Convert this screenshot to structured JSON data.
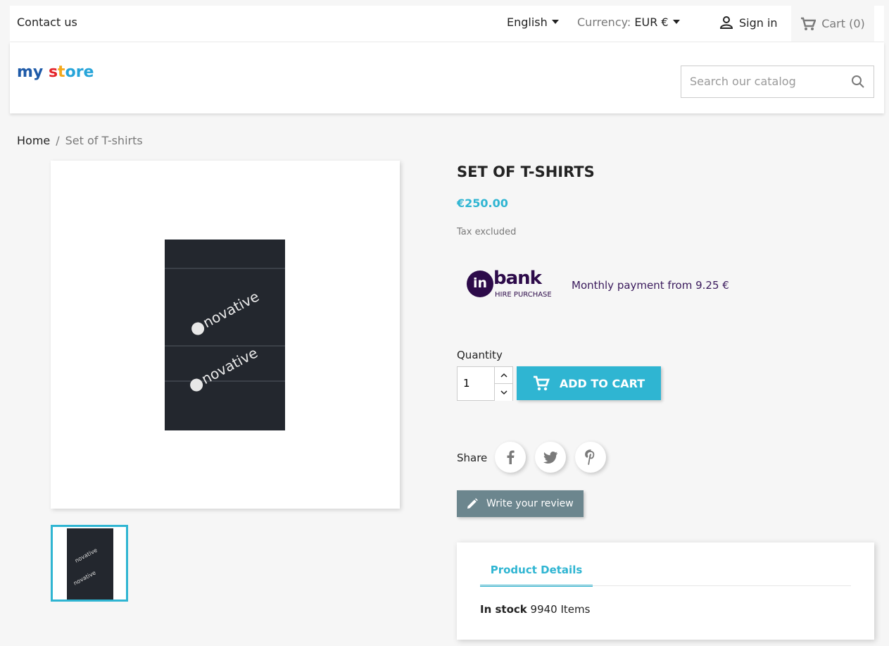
{
  "topbar": {
    "contact": "Contact us",
    "language": "English",
    "currency_label": "Currency:",
    "currency_value": "EUR €",
    "signin": "Sign in",
    "cart": "Cart (0)"
  },
  "header": {
    "logo_part1": "my",
    "logo_part2": "s",
    "logo_part3": "t",
    "logo_part4": "ore",
    "search_placeholder": "Search our catalog"
  },
  "breadcrumb": {
    "home": "Home",
    "separator": "/",
    "current": "Set of T-shirts"
  },
  "product": {
    "title": "SET OF T-SHIRTS",
    "price": "€250.00",
    "tax": "Tax excluded",
    "image_brand": "novative",
    "image_brand_prefix": "in"
  },
  "inbank": {
    "logo_prefix": "in",
    "logo_word": "bank",
    "logo_sub": "HIRE PURCHASE",
    "monthly": "Monthly payment from 9.25 €"
  },
  "purchase": {
    "quantity_label": "Quantity",
    "quantity_value": "1",
    "add_to_cart": "ADD TO CART"
  },
  "share": {
    "label": "Share"
  },
  "review": {
    "label": "Write your review"
  },
  "details": {
    "tab": "Product Details",
    "stock_label": "In stock",
    "stock_value": "9940 Items"
  },
  "colors": {
    "accent": "#2fb5d2",
    "review_button": "#6c868e",
    "inbank_purple": "#2d0b4a"
  },
  "icons": {
    "language_caret": "caret-down-icon",
    "currency_caret": "caret-down-icon",
    "signin": "person-icon",
    "cart": "cart-icon",
    "search": "search-icon",
    "qty_up": "chevron-up-icon",
    "qty_down": "chevron-down-icon",
    "add_to_cart": "cart-icon",
    "facebook": "facebook-icon",
    "twitter": "twitter-icon",
    "pinterest": "pinterest-icon",
    "review": "pencil-icon"
  }
}
